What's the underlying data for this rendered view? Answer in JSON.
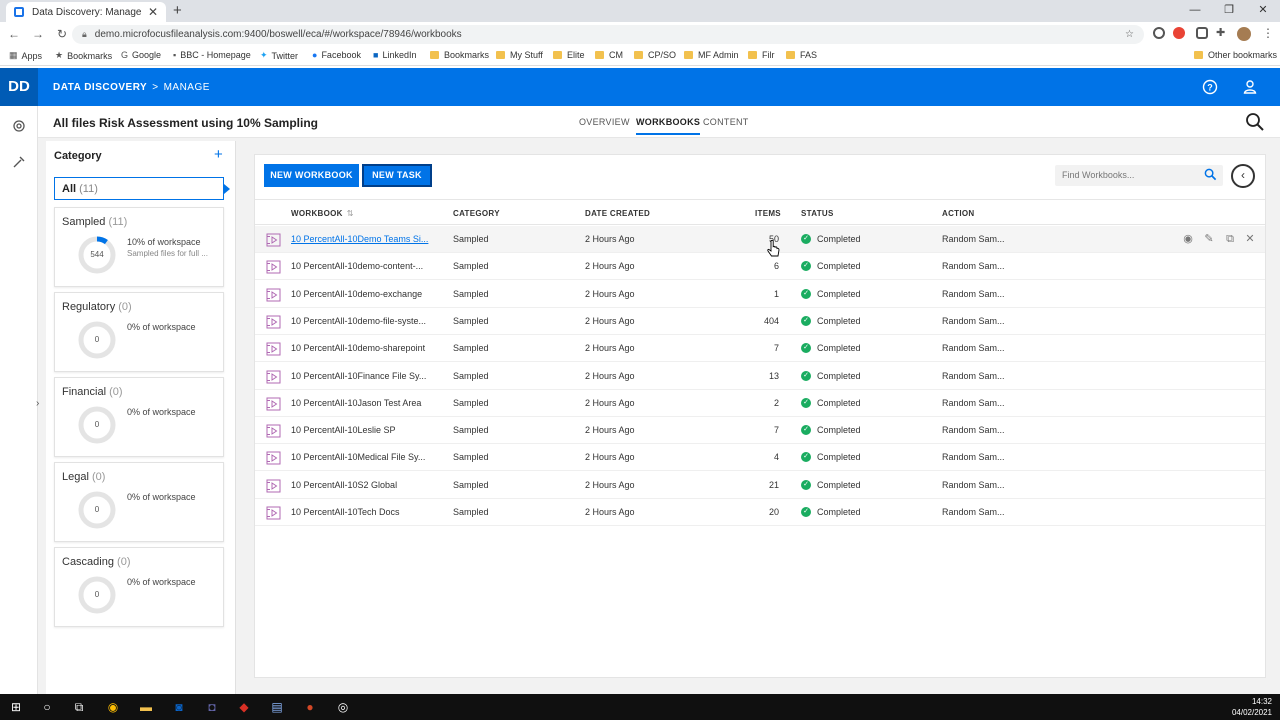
{
  "browser": {
    "tab_title": "Data Discovery: Manage",
    "url": "demo.microfocusfileanalysis.com:9400/boswell/eca/#/workspace/78946/workbooks",
    "bookmarks": [
      "Apps",
      "Bookmarks",
      "Google",
      "BBC - Homepage",
      "Twitter",
      "Facebook",
      "LinkedIn",
      "Bookmarks",
      "My Stuff",
      "Elite",
      "CM",
      "CP/SO",
      "MF Admin",
      "Filr",
      "FAS"
    ],
    "other_bookmarks": "Other bookmarks"
  },
  "app": {
    "logo": "DD",
    "breadcrumb_app": "DATA DISCOVERY",
    "breadcrumb_sep": ">",
    "breadcrumb_page": "MANAGE",
    "accent": "#0073e7"
  },
  "page": {
    "title": "All files Risk Assessment using 10% Sampling",
    "tabs": [
      "OVERVIEW",
      "WORKBOOKS",
      "CONTENT"
    ]
  },
  "sidebar": {
    "heading": "Category",
    "all_label": "All",
    "all_count": "(11)",
    "categories": [
      {
        "name": "Sampled",
        "count": "(11)",
        "value": "544",
        "percent": "10% of workspace",
        "desc": "Sampled files for full ...",
        "fill": 0.1
      },
      {
        "name": "Regulatory",
        "count": "(0)",
        "value": "0",
        "percent": "0% of workspace",
        "desc": "",
        "fill": 0
      },
      {
        "name": "Financial",
        "count": "(0)",
        "value": "0",
        "percent": "0% of workspace",
        "desc": "",
        "fill": 0
      },
      {
        "name": "Legal",
        "count": "(0)",
        "value": "0",
        "percent": "0% of workspace",
        "desc": "",
        "fill": 0
      },
      {
        "name": "Cascading",
        "count": "(0)",
        "value": "0",
        "percent": "0% of workspace",
        "desc": "",
        "fill": 0
      }
    ]
  },
  "toolbar": {
    "new_workbook": "NEW WORKBOOK",
    "new_task": "NEW TASK",
    "find_placeholder": "Find Workbooks..."
  },
  "table": {
    "headers": [
      "WORKBOOK",
      "CATEGORY",
      "DATE CREATED",
      "ITEMS",
      "STATUS",
      "ACTION"
    ],
    "rows": [
      {
        "workbook": "10 PercentAll-10Demo Teams Si...",
        "category": "Sampled",
        "date": "2 Hours Ago",
        "items": "50",
        "status": "Completed",
        "action": "Random Sam..."
      },
      {
        "workbook": "10 PercentAll-10demo-content-...",
        "category": "Sampled",
        "date": "2 Hours Ago",
        "items": "6",
        "status": "Completed",
        "action": "Random Sam..."
      },
      {
        "workbook": "10 PercentAll-10demo-exchange",
        "category": "Sampled",
        "date": "2 Hours Ago",
        "items": "1",
        "status": "Completed",
        "action": "Random Sam..."
      },
      {
        "workbook": "10 PercentAll-10demo-file-syste...",
        "category": "Sampled",
        "date": "2 Hours Ago",
        "items": "404",
        "status": "Completed",
        "action": "Random Sam..."
      },
      {
        "workbook": "10 PercentAll-10demo-sharepoint",
        "category": "Sampled",
        "date": "2 Hours Ago",
        "items": "7",
        "status": "Completed",
        "action": "Random Sam..."
      },
      {
        "workbook": "10 PercentAll-10Finance File Sy...",
        "category": "Sampled",
        "date": "2 Hours Ago",
        "items": "13",
        "status": "Completed",
        "action": "Random Sam..."
      },
      {
        "workbook": "10 PercentAll-10Jason Test Area",
        "category": "Sampled",
        "date": "2 Hours Ago",
        "items": "2",
        "status": "Completed",
        "action": "Random Sam..."
      },
      {
        "workbook": "10 PercentAll-10Leslie SP",
        "category": "Sampled",
        "date": "2 Hours Ago",
        "items": "7",
        "status": "Completed",
        "action": "Random Sam..."
      },
      {
        "workbook": "10 PercentAll-10Medical File Sy...",
        "category": "Sampled",
        "date": "2 Hours Ago",
        "items": "4",
        "status": "Completed",
        "action": "Random Sam..."
      },
      {
        "workbook": "10 PercentAll-10S2 Global",
        "category": "Sampled",
        "date": "2 Hours Ago",
        "items": "21",
        "status": "Completed",
        "action": "Random Sam..."
      },
      {
        "workbook": "10 PercentAll-10Tech Docs",
        "category": "Sampled",
        "date": "2 Hours Ago",
        "items": "20",
        "status": "Completed",
        "action": "Random Sam..."
      }
    ]
  },
  "taskbar": {
    "time": "14:32",
    "date": "04/02/2021"
  }
}
